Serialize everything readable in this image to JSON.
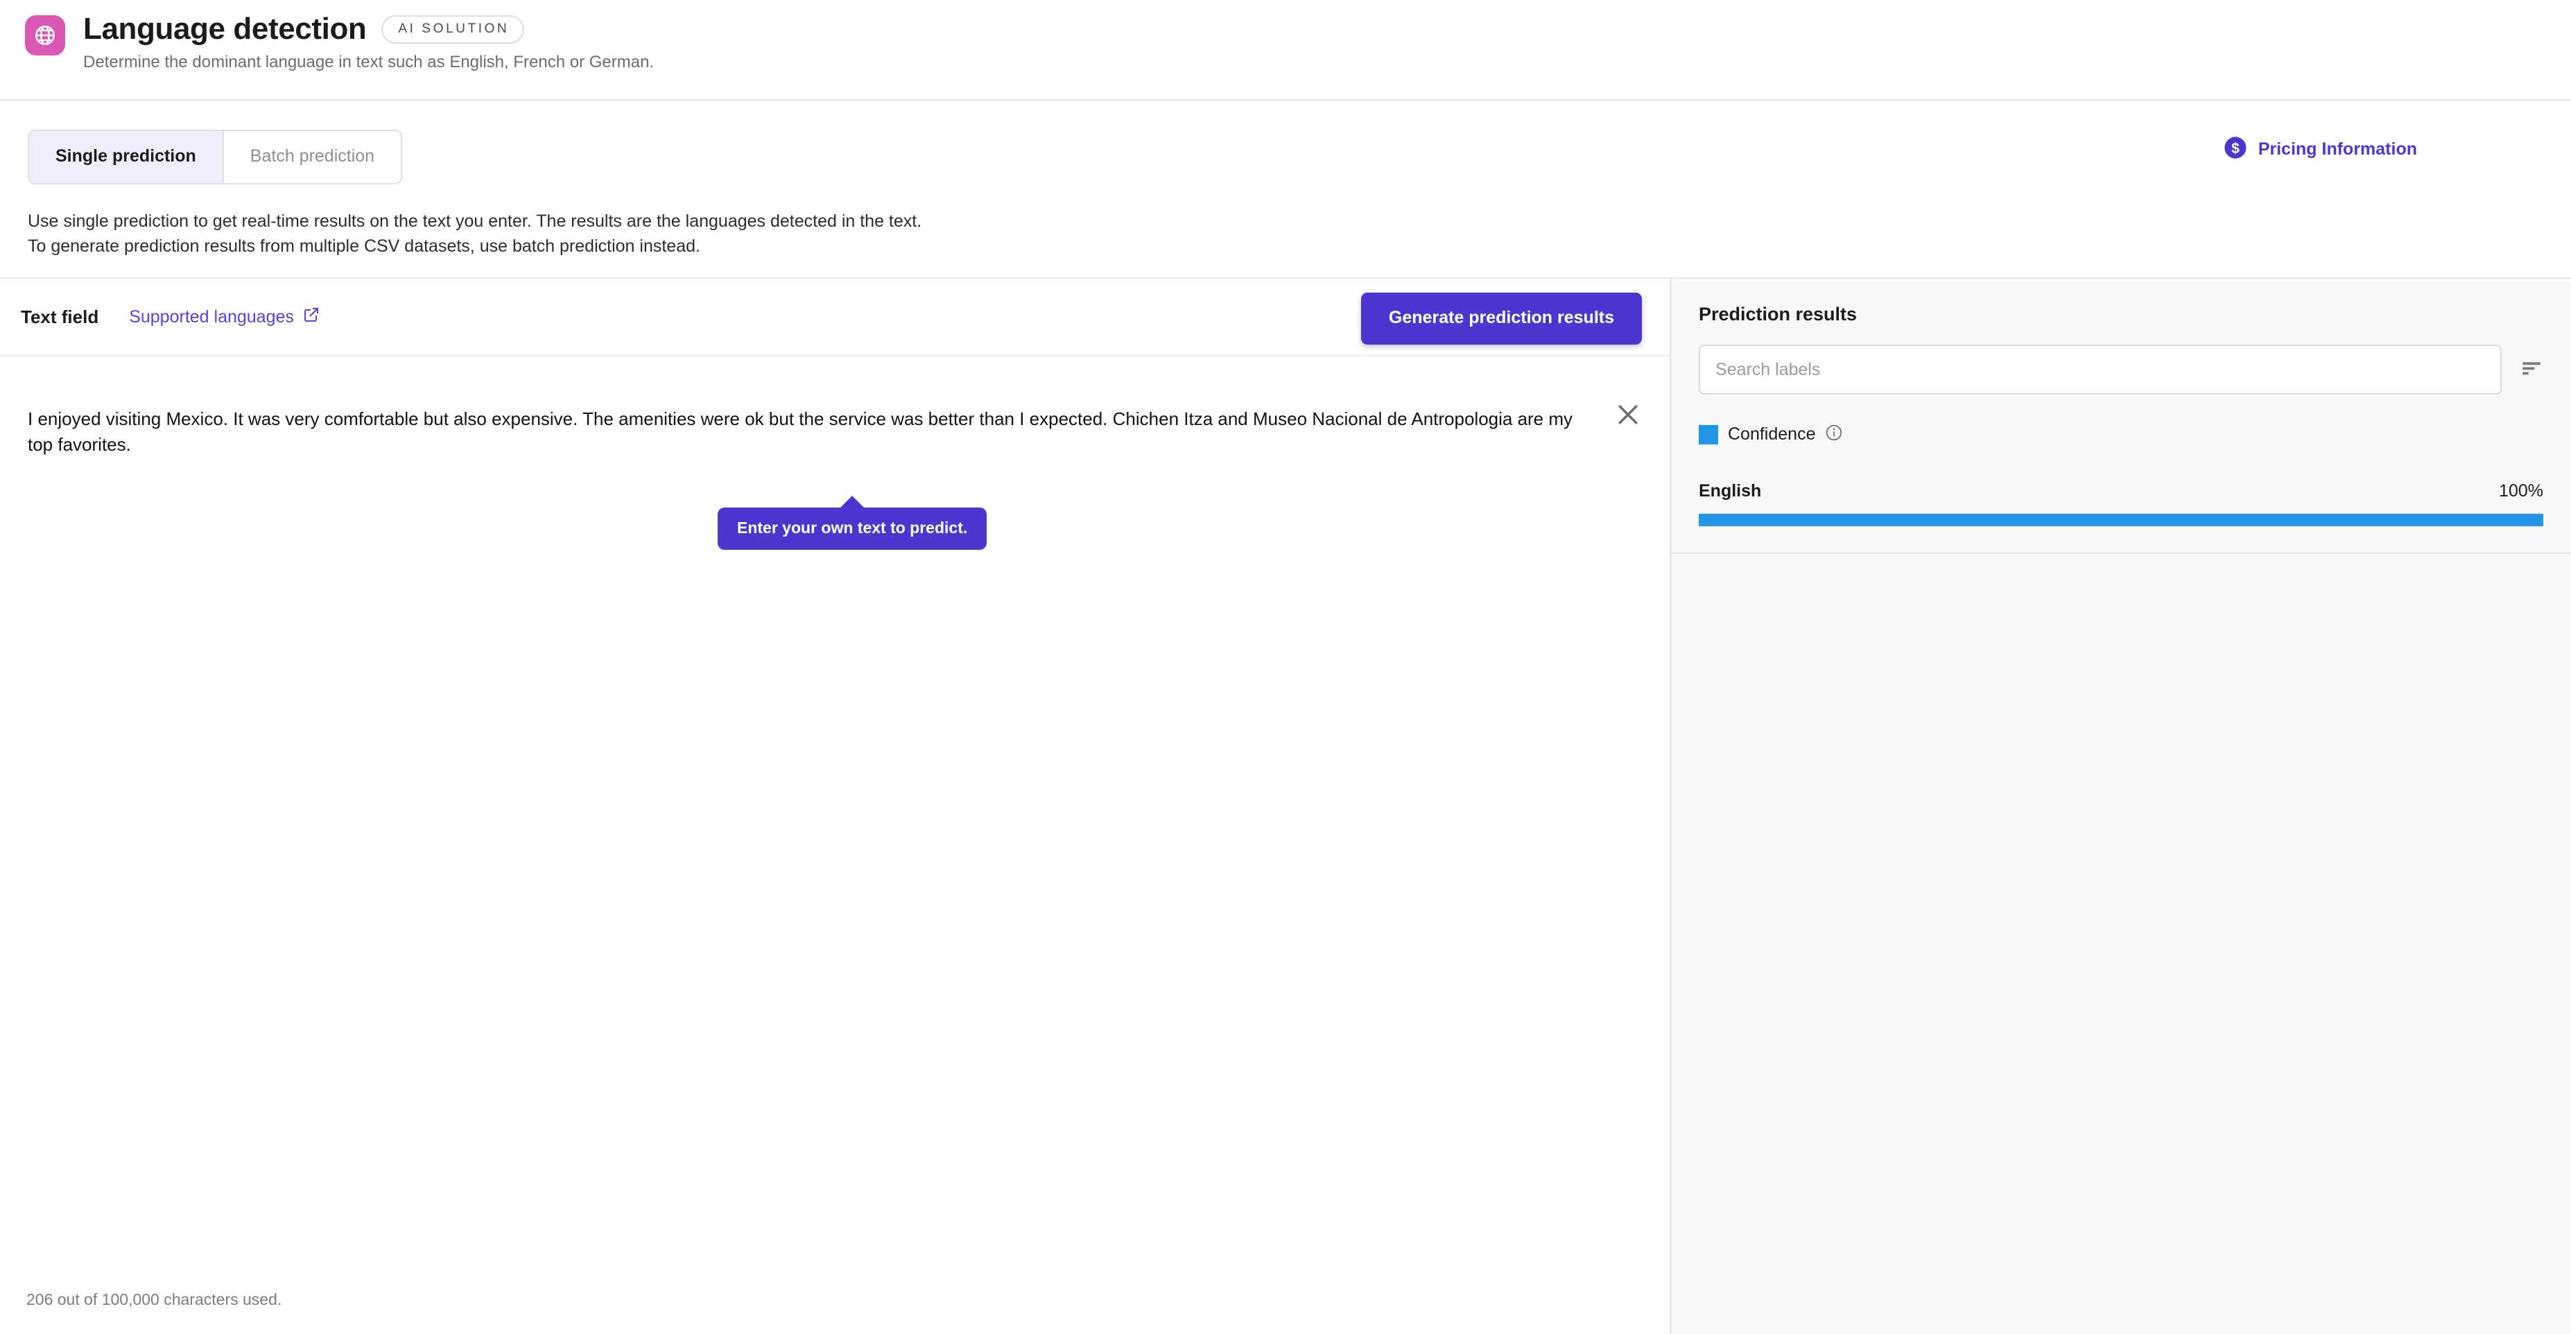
{
  "header": {
    "icon": "globe-icon",
    "icon_color": "#da58b4",
    "title": "Language detection",
    "badge": "AI SOLUTION",
    "subtitle": "Determine the dominant language in text such as English, French or German."
  },
  "tabs": [
    {
      "label": "Single prediction",
      "active": true
    },
    {
      "label": "Batch prediction",
      "active": false
    }
  ],
  "intro": {
    "line1": "Use single prediction to get real-time results on the text you enter. The results are the languages detected in the text.",
    "line2": "To generate prediction results from multiple CSV datasets, use batch prediction instead."
  },
  "pricing": {
    "icon": "dollar-circle-icon",
    "label": "Pricing Information",
    "color": "#4b37cf"
  },
  "text_field": {
    "label": "Text field",
    "supported_languages_link": "Supported languages",
    "link_icon": "external-link-icon",
    "generate_button": "Generate prediction results",
    "clear_icon": "close-icon",
    "value": "I enjoyed visiting Mexico. It was very comfortable but also expensive. The amenities were ok but the service was better than I expected. Chichen Itza and Museo Nacional de Antropologia are my top favorites.",
    "tooltip": "Enter your own text to predict.",
    "char_counter": "206 out of 100,000 characters used."
  },
  "results": {
    "title": "Prediction results",
    "search_placeholder": "Search labels",
    "search_value": "",
    "sort_icon": "sort-icon",
    "legend": {
      "label": "Confidence",
      "color": "#2196e8",
      "info_icon": "info-icon"
    },
    "items": [
      {
        "label": "English",
        "value": "100%",
        "percent": 100
      }
    ]
  }
}
